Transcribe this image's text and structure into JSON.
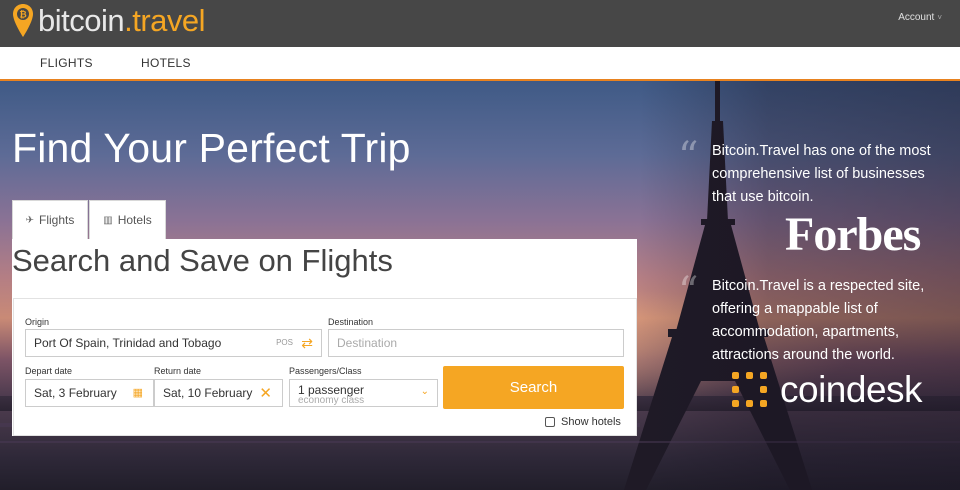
{
  "brand": {
    "name_part1": "bitcoin",
    "name_part2": ".travel",
    "accent": "#f5a623"
  },
  "header": {
    "account_label": "Account"
  },
  "nav": {
    "items": [
      {
        "label": "FLIGHTS"
      },
      {
        "label": "HOTELS"
      }
    ]
  },
  "hero": {
    "title": "Find Your Perfect Trip"
  },
  "tabs": [
    {
      "label": "Flights",
      "icon": "plane-icon"
    },
    {
      "label": "Hotels",
      "icon": "building-icon"
    }
  ],
  "search": {
    "title": "Search and Save on Flights",
    "origin": {
      "label": "Origin",
      "value": "Port Of Spain, Trinidad and Tobago",
      "code": "POS"
    },
    "destination": {
      "label": "Destination",
      "placeholder": "Destination"
    },
    "depart": {
      "label": "Depart date",
      "value": "Sat, 3 February"
    },
    "return": {
      "label": "Return date",
      "value": "Sat, 10 February"
    },
    "passengers": {
      "label": "Passengers/Class",
      "value": "1 passenger",
      "class": "economy class"
    },
    "button_label": "Search",
    "show_hotels_label": "Show hotels",
    "show_hotels_checked": false
  },
  "quotes": [
    {
      "text": "Bitcoin.Travel has one of the most comprehensive list of businesses that use bitcoin.",
      "source": "Forbes"
    },
    {
      "text": "Bitcoin.Travel is a respected site, offering a mappable list of accommodation, apartments, attractions around the world.",
      "source": "coindesk"
    }
  ]
}
